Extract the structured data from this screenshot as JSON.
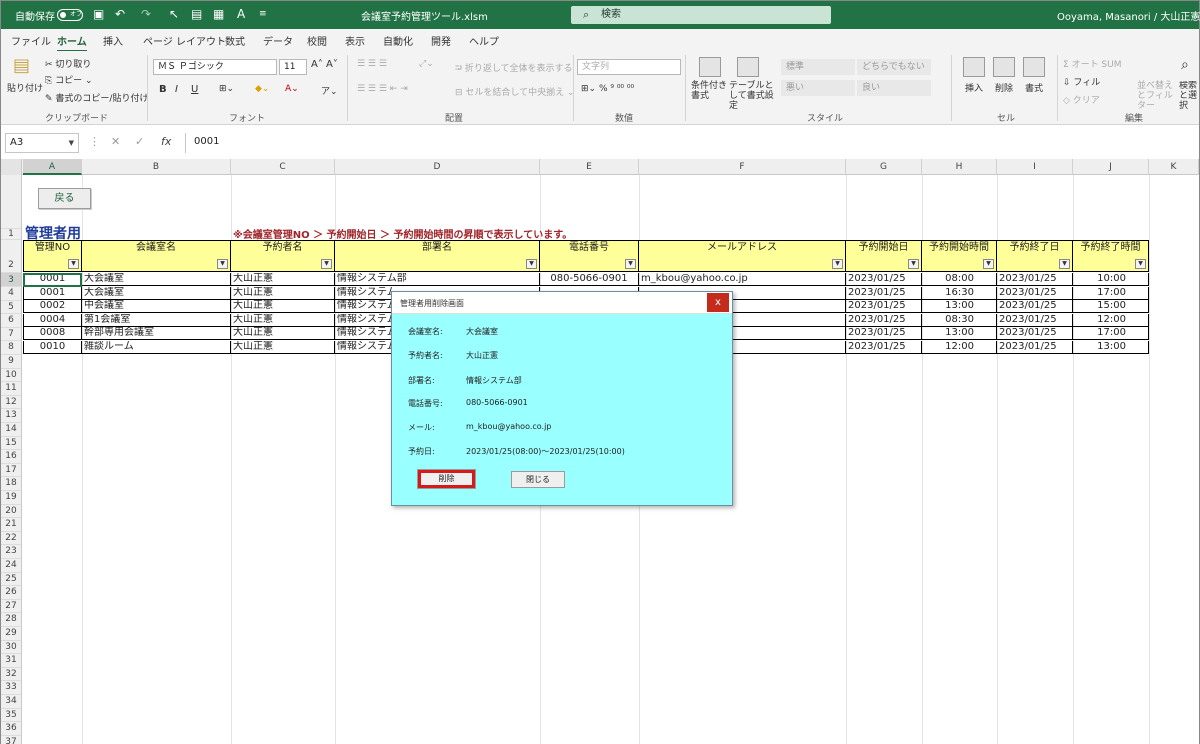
{
  "titlebar": {
    "autosave_label": "自動保存",
    "autosave_state": "オフ",
    "filename": "会議室予約管理ツール.xlsm",
    "search_placeholder": "検索",
    "user": "Ooyama, Masanori / 大山正憲",
    "colors": {
      "excel_green": "#217346"
    }
  },
  "tabs": [
    "ファイル",
    "ホーム",
    "挿入",
    "ページ レイアウト",
    "数式",
    "データ",
    "校閲",
    "表示",
    "自動化",
    "開発",
    "ヘルプ"
  ],
  "active_tab": "ホーム",
  "ribbon": {
    "clipboard": {
      "paste": "貼り付け",
      "cut": "切り取り",
      "copy": "コピー",
      "format_painter": "書式のコピー/貼り付け",
      "group": "クリップボード"
    },
    "font": {
      "name": "ＭＳ Ｐゴシック",
      "size": "11",
      "group": "フォント"
    },
    "alignment": {
      "wrap": "折り返して全体を表示する",
      "merge": "セルを結合して中央揃え",
      "group": "配置"
    },
    "number": {
      "format": "文字列",
      "group": "数値"
    },
    "styles": {
      "conditional": "条件付き書式",
      "table": "テーブルとして書式設定",
      "standard": "標準",
      "neutral": "どちらでもない",
      "bad": "悪い",
      "good": "良い",
      "group": "スタイル"
    },
    "cells": {
      "insert": "挿入",
      "delete": "削除",
      "format": "書式",
      "group": "セル"
    },
    "editing": {
      "autosum": "オート SUM",
      "fill": "フィル",
      "clear": "クリア",
      "sort": "並べ替えとフィルター",
      "find": "検索と選択",
      "group": "編集"
    }
  },
  "formula_bar": {
    "cell_ref": "A3",
    "value": "0001"
  },
  "columns": [
    "A",
    "B",
    "C",
    "D",
    "E",
    "F",
    "G",
    "H",
    "I",
    "J",
    "K"
  ],
  "selected_column": "A",
  "selected_row": "3",
  "rows_visible": [
    "1",
    "2",
    "3",
    "4",
    "5",
    "6",
    "7",
    "8",
    "9",
    "10",
    "11",
    "12",
    "13",
    "14",
    "15",
    "16",
    "17",
    "18",
    "19",
    "20",
    "21",
    "22",
    "23",
    "24",
    "25",
    "26",
    "27",
    "28",
    "29",
    "30",
    "31",
    "32",
    "33",
    "34",
    "35",
    "36",
    "37"
  ],
  "sheet": {
    "back_button": "戻る",
    "title": "管理者用",
    "note": "※会議室管理NO ＞ 予約開始日 ＞ 予約開始時間の昇順で表示しています。",
    "headers": [
      "管理NO",
      "会議室名",
      "予約者名",
      "部署名",
      "電話番号",
      "メールアドレス",
      "予約開始日",
      "予約開始時間",
      "予約終了日",
      "予約終了時間"
    ],
    "filter_icon": "▼",
    "rows": [
      [
        "0001",
        "大会議室",
        "大山正憲",
        "情報システム部",
        "080-5066-0901",
        "m_kbou@yahoo.co.jp",
        "2023/01/25",
        "08:00",
        "2023/01/25",
        "10:00"
      ],
      [
        "0001",
        "大会議室",
        "大山正憲",
        "情報システム",
        "",
        "",
        "2023/01/25",
        "16:30",
        "2023/01/25",
        "17:00"
      ],
      [
        "0002",
        "中会議室",
        "大山正憲",
        "情報システム",
        "",
        "",
        "2023/01/25",
        "13:00",
        "2023/01/25",
        "15:00"
      ],
      [
        "0004",
        "第1会議室",
        "大山正憲",
        "情報システム",
        "",
        "",
        "2023/01/25",
        "08:30",
        "2023/01/25",
        "12:00"
      ],
      [
        "0008",
        "幹部専用会議室",
        "大山正憲",
        "情報システム",
        "",
        "",
        "2023/01/25",
        "13:00",
        "2023/01/25",
        "17:00"
      ],
      [
        "0010",
        "雑談ルーム",
        "大山正憲",
        "情報システム",
        "",
        "",
        "2023/01/25",
        "12:00",
        "2023/01/25",
        "13:00"
      ]
    ]
  },
  "dialog": {
    "title": "管理者用削除画面",
    "close": "x",
    "fields": [
      {
        "label": "会議室名:",
        "value": "大会議室"
      },
      {
        "label": "予約者名:",
        "value": "大山正憲"
      },
      {
        "label": "部署名:",
        "value": "情報システム部"
      },
      {
        "label": "電話番号:",
        "value": "080-5066-0901"
      },
      {
        "label": "メール:",
        "value": "m_kbou@yahoo.co.jp"
      },
      {
        "label": "予約日:",
        "value": "2023/01/25(08:00)～2023/01/25(10:00)"
      }
    ],
    "delete_button": "削除",
    "close_button": "閉じる",
    "colors": {
      "background": "#99ffff",
      "highlight": "#d41a1a"
    }
  }
}
